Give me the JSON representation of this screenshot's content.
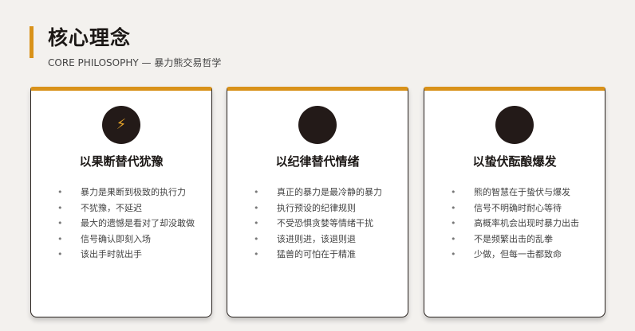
{
  "header": {
    "title": "核心理念",
    "subtitle": "CORE PHILOSOPHY — 暴力熊交易哲学"
  },
  "colors": {
    "accent": "#d9921a",
    "icon_bg": "#231a18",
    "card_bg": "#ffffff",
    "page_bg": "#f3f1ee"
  },
  "cards": [
    {
      "icon": "lightning-icon",
      "icon_glyph": "⚡",
      "title": "以果断替代犹豫",
      "points": [
        "暴力是果断到极致的执行力",
        "不犹豫，不延迟",
        "最大的遗憾是看对了却没敢做",
        "信号确认即刻入场",
        "该出手时就出手"
      ]
    },
    {
      "icon": "dark-circle-icon",
      "icon_glyph": "",
      "title": "以纪律替代情绪",
      "points": [
        "真正的暴力是最冷静的暴力",
        "执行预设的纪律规则",
        "不受恐惧贪婪等情绪干扰",
        "该进则进，该退则退",
        "猛兽的可怕在于精准"
      ]
    },
    {
      "icon": "dark-circle-icon",
      "icon_glyph": "",
      "title": "以蛰伏酝酿爆发",
      "points": [
        "熊的智慧在于蛰伏与爆发",
        "信号不明确时耐心等待",
        "高概率机会出现时暴力出击",
        "不是频繁出击的乱拳",
        "少做，但每一击都致命"
      ]
    }
  ]
}
